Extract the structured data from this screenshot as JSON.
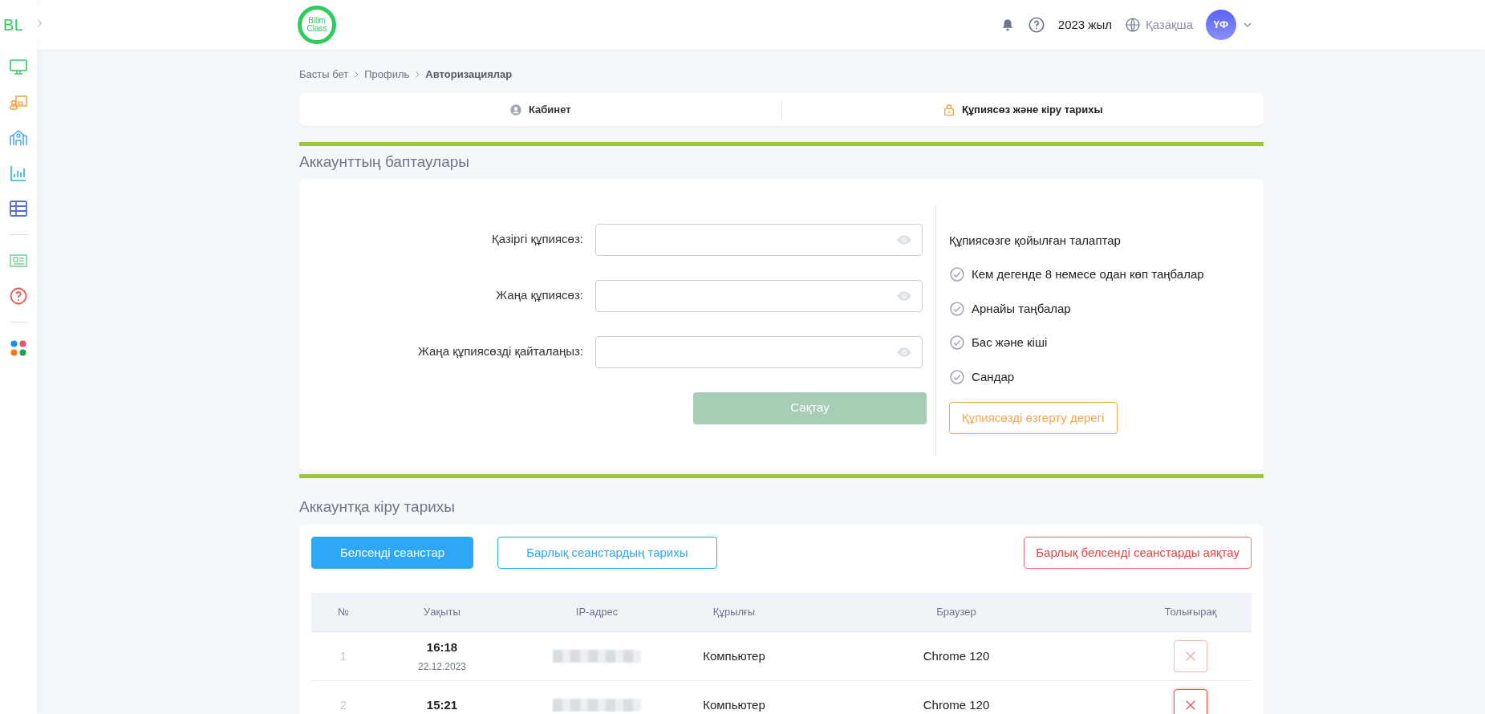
{
  "sidebar": {
    "logo": "BL",
    "items": [
      {
        "kind": "monitor",
        "selected": false
      },
      {
        "kind": "teacher",
        "selected": false
      },
      {
        "kind": "school",
        "selected": false
      },
      {
        "kind": "chart",
        "selected": false
      },
      {
        "kind": "table",
        "selected": false
      },
      {
        "kind": "divider"
      },
      {
        "kind": "news",
        "selected": false
      },
      {
        "kind": "help",
        "selected": false
      },
      {
        "kind": "divider"
      },
      {
        "kind": "apps",
        "selected": false
      }
    ]
  },
  "header": {
    "logo_text": [
      "Bilim",
      "Class"
    ],
    "year": "2023 жыл",
    "language": "Қазақша",
    "avatar": "ҮФ"
  },
  "breadcrumbs": [
    {
      "label": "Басты бет",
      "current": false
    },
    {
      "label": "Профиль",
      "current": false
    },
    {
      "label": "Авторизациялар",
      "current": true
    }
  ],
  "tabs": [
    {
      "label": "Кабинет",
      "kind": "profile",
      "selected": false
    },
    {
      "label": "Құпиясөз және кіру тарихы",
      "kind": "security",
      "selected": true
    }
  ],
  "account_settings": {
    "title": "Аккаунттың баптаулары",
    "fields": [
      {
        "label": "Қазіргі құпиясөз:"
      },
      {
        "label": "Жаңа құпиясөз:"
      },
      {
        "label": "Жаңа құпиясөзді қайталаңыз:"
      }
    ],
    "save_button": {
      "label": "Сақтау",
      "disabled": true
    },
    "requirements_title": "Құпиясөзге қойылған талаптар",
    "requirements": [
      {
        "label": "Кем дегенде 8 немесе одан көп таңбалар",
        "checked": false
      },
      {
        "label": "Арнайы таңбалар",
        "checked": false
      },
      {
        "label": "Бас және кіші",
        "checked": false
      },
      {
        "label": "Сандар",
        "checked": false
      }
    ],
    "change_date_button": "Құпиясөзді өзгерту дерегі"
  },
  "login_history": {
    "title": "Аккаунтқа кіру тарихы",
    "tabs": [
      {
        "label": "Белсенді сеанстар",
        "selected": true
      },
      {
        "label": "Барлық сеанстардың тарихы",
        "selected": false
      }
    ],
    "end_all_button": "Барлық белсенді сеанстарды аяқтау",
    "columns": [
      "№",
      "Уақыты",
      "IP-адрес",
      "Құрылғы",
      "Браузер",
      "Толығырақ"
    ],
    "rows": [
      {
        "index": "1",
        "time": "16:18",
        "date": "22.12.2023",
        "device": "Компьютер",
        "browser": "Chrome 120",
        "hovered": false
      },
      {
        "index": "2",
        "time": "15:21",
        "device": "Компьютер",
        "browser": "Chrome 120",
        "hovered": true
      }
    ]
  }
}
